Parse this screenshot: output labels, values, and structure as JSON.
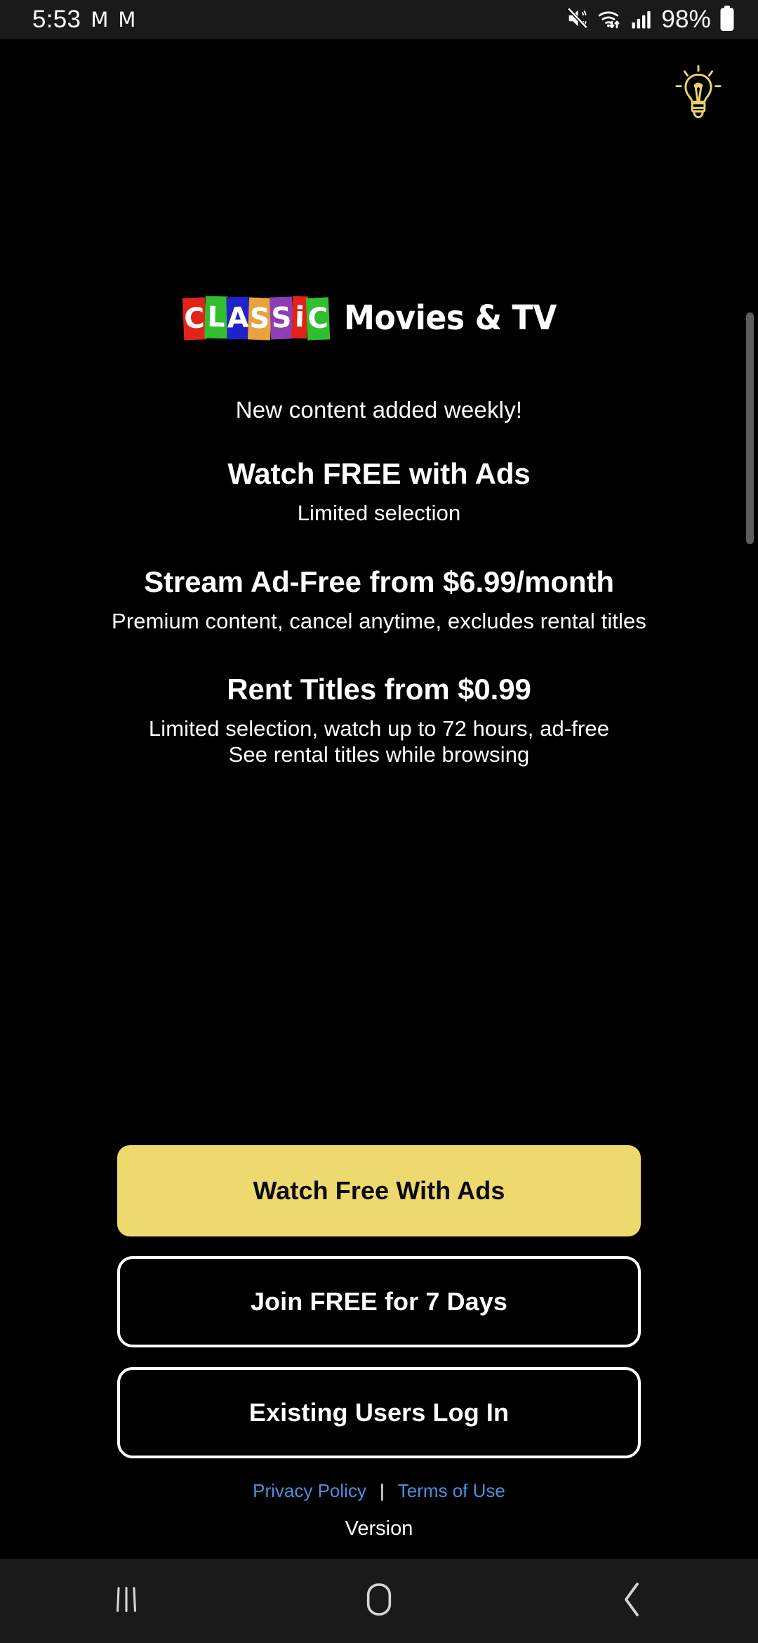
{
  "status_bar": {
    "time": "5:53",
    "app_icons": [
      "M",
      "M"
    ],
    "icons": [
      "mute-icon",
      "wifi-icon",
      "cellular-signal-icon",
      "battery-icon"
    ],
    "battery_percent": "98%"
  },
  "header": {
    "hint_icon": "lightbulb-icon",
    "hint_color": "#e8d46a"
  },
  "logo": {
    "classic_letters": [
      {
        "char": "C",
        "color": "#e2231a"
      },
      {
        "char": "L",
        "color": "#2fbf2f"
      },
      {
        "char": "A",
        "color": "#2222cc"
      },
      {
        "char": "S",
        "color": "#e8a33d"
      },
      {
        "char": "S",
        "color": "#8c3fb5"
      },
      {
        "char": "i",
        "color": "#e2231a"
      },
      {
        "char": "C",
        "color": "#2fbf2f"
      }
    ],
    "wordmark": "Movies & TV"
  },
  "main": {
    "tagline": "New content added weekly!",
    "blocks": [
      {
        "head": "Watch FREE with Ads",
        "sub": "Limited selection"
      },
      {
        "head": "Stream Ad-Free from $6.99/month",
        "sub": "Premium content, cancel anytime, excludes rental titles"
      },
      {
        "head": "Rent Titles from $0.99",
        "sub_line1": "Limited selection, watch up to 72 hours, ad-free",
        "sub_line2": "See rental titles while browsing"
      }
    ]
  },
  "buttons": {
    "watch_free": "Watch Free With Ads",
    "join_free": "Join FREE for 7 Days",
    "log_in": "Existing Users Log In",
    "primary_color": "#eed96e"
  },
  "footer": {
    "privacy_policy": "Privacy Policy",
    "separator": "|",
    "terms_of_use": "Terms of Use",
    "version": "Version",
    "link_color": "#4a90d9"
  },
  "nav_bar": {
    "recents": "recents-icon",
    "home": "home-icon",
    "back": "back-icon"
  }
}
